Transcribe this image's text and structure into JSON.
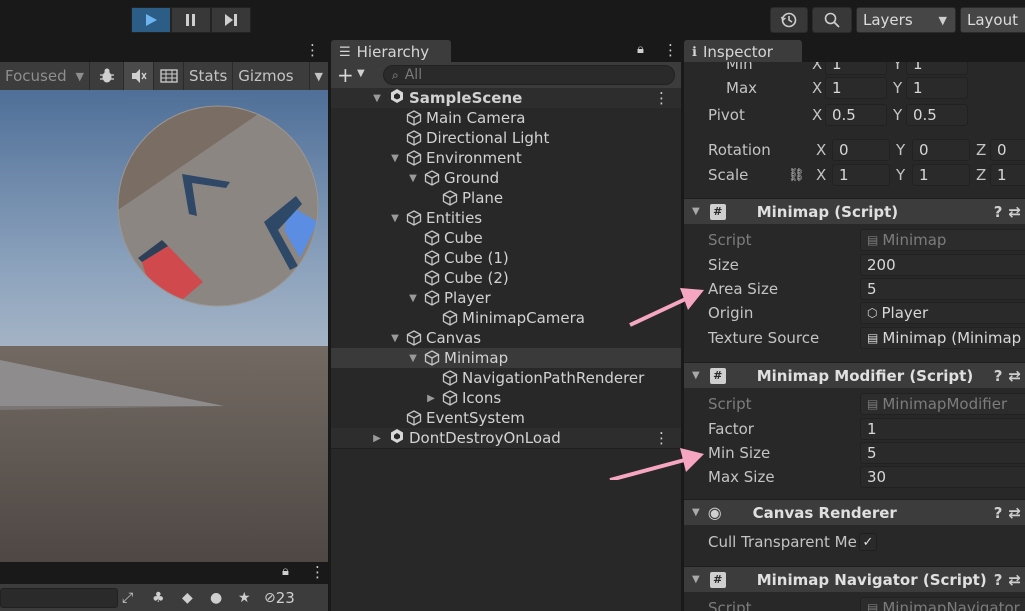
{
  "toolbar": {
    "play_icon": "play-icon",
    "pause_icon": "pause-icon",
    "step_icon": "step-icon",
    "history_icon": "history-icon",
    "search_icon": "search-icon",
    "layers_label": "Layers",
    "layout_label": "Layout"
  },
  "game": {
    "focused_label": "Focused",
    "stats_label": "Stats",
    "gizmos_label": "Gizmos",
    "hidden_count": "23"
  },
  "hierarchy": {
    "tab_label": "Hierarchy",
    "search_placeholder": "All",
    "add_label": "+",
    "items": [
      {
        "label": "SampleScene"
      },
      {
        "label": "Main Camera"
      },
      {
        "label": "Directional Light"
      },
      {
        "label": "Environment"
      },
      {
        "label": "Ground"
      },
      {
        "label": "Plane"
      },
      {
        "label": "Entities"
      },
      {
        "label": "Cube"
      },
      {
        "label": "Cube (1)"
      },
      {
        "label": "Cube (2)"
      },
      {
        "label": "Player"
      },
      {
        "label": "MinimapCamera"
      },
      {
        "label": "Canvas"
      },
      {
        "label": "Minimap"
      },
      {
        "label": "NavigationPathRenderer"
      },
      {
        "label": "Icons"
      },
      {
        "label": "EventSystem"
      },
      {
        "label": "DontDestroyOnLoad"
      }
    ]
  },
  "inspector": {
    "tab_label": "Inspector",
    "rect": {
      "min_label": "Min",
      "min_x": "1",
      "min_y": "1",
      "max_label": "Max",
      "max_x": "1",
      "max_y": "1",
      "pivot_label": "Pivot",
      "pivot_x": "0.5",
      "pivot_y": "0.5",
      "rotation_label": "Rotation",
      "rot_x": "0",
      "rot_y": "0",
      "rot_z": "0",
      "scale_label": "Scale",
      "scale_x": "1",
      "scale_y": "1",
      "scale_z": "1",
      "axis_x": "X",
      "axis_y": "Y",
      "axis_z": "Z"
    },
    "minimap": {
      "title": "Minimap (Script)",
      "script_label": "Script",
      "script_value": "Minimap",
      "size_label": "Size",
      "size_value": "200",
      "area_label": "Area Size",
      "area_value": "5",
      "origin_label": "Origin",
      "origin_value": "Player",
      "texture_label": "Texture Source",
      "texture_value": "Minimap (Minimap R"
    },
    "modifier": {
      "title": "Minimap Modifier (Script)",
      "script_label": "Script",
      "script_value": "MinimapModifier",
      "factor_label": "Factor",
      "factor_value": "1",
      "min_label": "Min Size",
      "min_value": "5",
      "max_label": "Max Size",
      "max_value": "30"
    },
    "canvas_renderer": {
      "title": "Canvas Renderer",
      "cull_label": "Cull Transparent Me"
    },
    "navigator": {
      "title": "Minimap Navigator (Script)",
      "script_label": "Script",
      "script_value": "MinimapNavigator"
    }
  },
  "colors": {
    "accent": "#2c5d87",
    "annotation_arrow": "#f6a6c1",
    "sky": "#5d7ea6",
    "ground": "#6c6058"
  }
}
